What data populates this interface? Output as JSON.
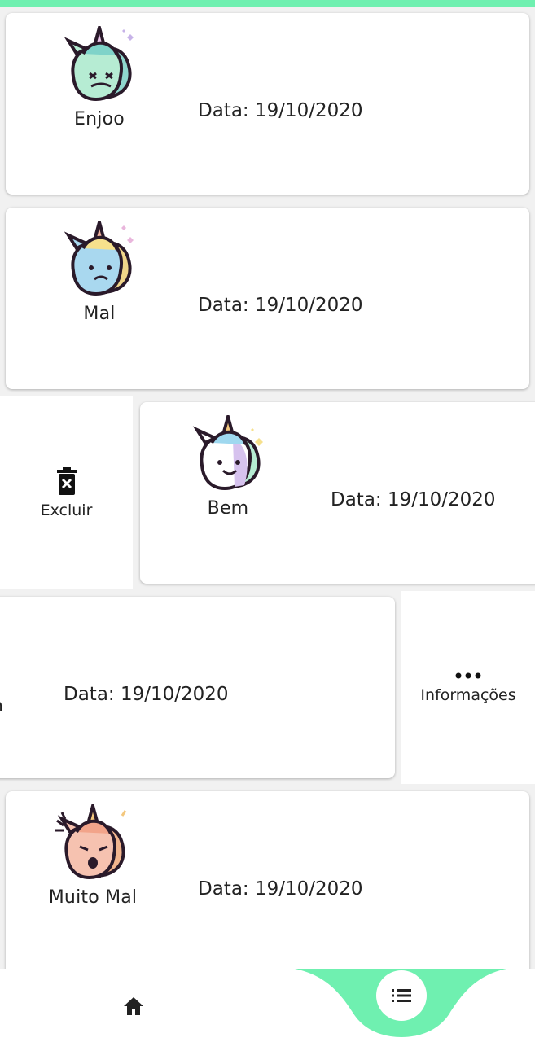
{
  "theme": {
    "accent": "#6ff0b0"
  },
  "entries": [
    {
      "mood": "Enjoo",
      "date": "Data: 19/10/2020",
      "icon": "unicorn-nauseous-icon"
    },
    {
      "mood": "Mal",
      "date": "Data: 19/10/2020",
      "icon": "unicorn-sad-icon"
    },
    {
      "mood": "Bem",
      "date": "Data: 19/10/2020",
      "icon": "unicorn-happy-icon"
    },
    {
      "mood": "",
      "date": "Data: 19/10/2020",
      "icon": ""
    },
    {
      "mood": "Muito Mal",
      "date": "Data: 19/10/2020",
      "icon": "unicorn-angry-icon"
    }
  ],
  "actions": {
    "delete_label": "Excluir",
    "info_label": "Informações"
  },
  "partial_label": "n",
  "bottom_nav": {
    "home_icon": "home-icon",
    "list_icon": "list-icon"
  }
}
